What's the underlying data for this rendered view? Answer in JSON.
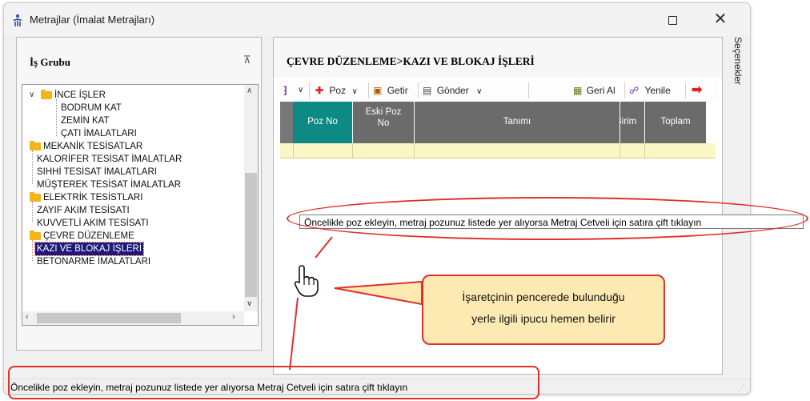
{
  "window": {
    "title": "Metrajlar (İmalat Metrajları)",
    "maximize_icon": "maximize-icon",
    "close_symbol": "✕"
  },
  "left_panel": {
    "title": "İş Grubu",
    "pin_symbol": "⊼",
    "tree": [
      {
        "label": "İNCE İŞLER",
        "level": 1,
        "folder": true,
        "expanded": true
      },
      {
        "label": "BODRUM KAT",
        "level": 2
      },
      {
        "label": "ZEMİN KAT",
        "level": 2
      },
      {
        "label": "ÇATI İMALATLARI",
        "level": 2
      },
      {
        "label": "MEKANİK TESİSATLAR",
        "level": 0,
        "folder": true,
        "expanded": true
      },
      {
        "label": "KALORİFER TESİSAT İMALATLAR",
        "level": 1
      },
      {
        "label": "SIHHİ TESİSAT İMALATLARI",
        "level": 1
      },
      {
        "label": "MÜŞTEREK TESİSAT İMALATLAR",
        "level": 1
      },
      {
        "label": "ELEKTRİK TESİSTLARI",
        "level": 0,
        "folder": true,
        "expanded": true
      },
      {
        "label": "ZAYIF AKIM TESİSATI",
        "level": 1
      },
      {
        "label": "KUVVETLİ AKIM TESİSATI",
        "level": 1
      },
      {
        "label": "ÇEVRE DÜZENLEME",
        "level": 0,
        "folder": true,
        "expanded": true
      },
      {
        "label": "KAZI VE BLOKAJ İŞLERİ",
        "level": 1,
        "selected": true
      },
      {
        "label": "BETONARME İMALATLARI",
        "level": 1
      }
    ]
  },
  "right_panel": {
    "title": "ÇEVRE DÜZENLEME>KAZI VE BLOKAJ İŞLERİ",
    "toolbar": {
      "poz": "Poz",
      "getir": "Getir",
      "gonder": "Gönder",
      "geri_al": "Geri Al",
      "yenile": "Yenile"
    },
    "grid": {
      "columns": [
        "Poz No",
        "Eski Poz No",
        "Tanımı",
        "Birim",
        "Toplam"
      ],
      "col_poz": "Poz No",
      "col_eski_1": "Eski Poz",
      "col_eski_2": "No",
      "col_tanim": "Tanımı",
      "col_birim": "Birim",
      "col_toplam": "Toplam"
    }
  },
  "side_tab": "Seçenekler",
  "tooltip": "Öncelikle poz ekleyin, metraj pozunuz listede yer alıyorsa Metraj Cetveli için satıra çift tıklayın",
  "status_bar": "Öncelikle poz ekleyin, metraj pozunuz listede yer alıyorsa Metraj Cetveli için satıra çift tıklayın",
  "callout": {
    "line1": "İşaretçinin pencerede bulunduğu",
    "line2": "yerle ilgili ipucu hemen belirir"
  },
  "colors": {
    "grid_header": "#6b6b6b",
    "grid_header_active": "#0e8a84",
    "grid_row": "#fbf6c6",
    "selection": "#1e1a7a",
    "annotation": "#e0302a",
    "callout_bg": "#fdeab3"
  }
}
